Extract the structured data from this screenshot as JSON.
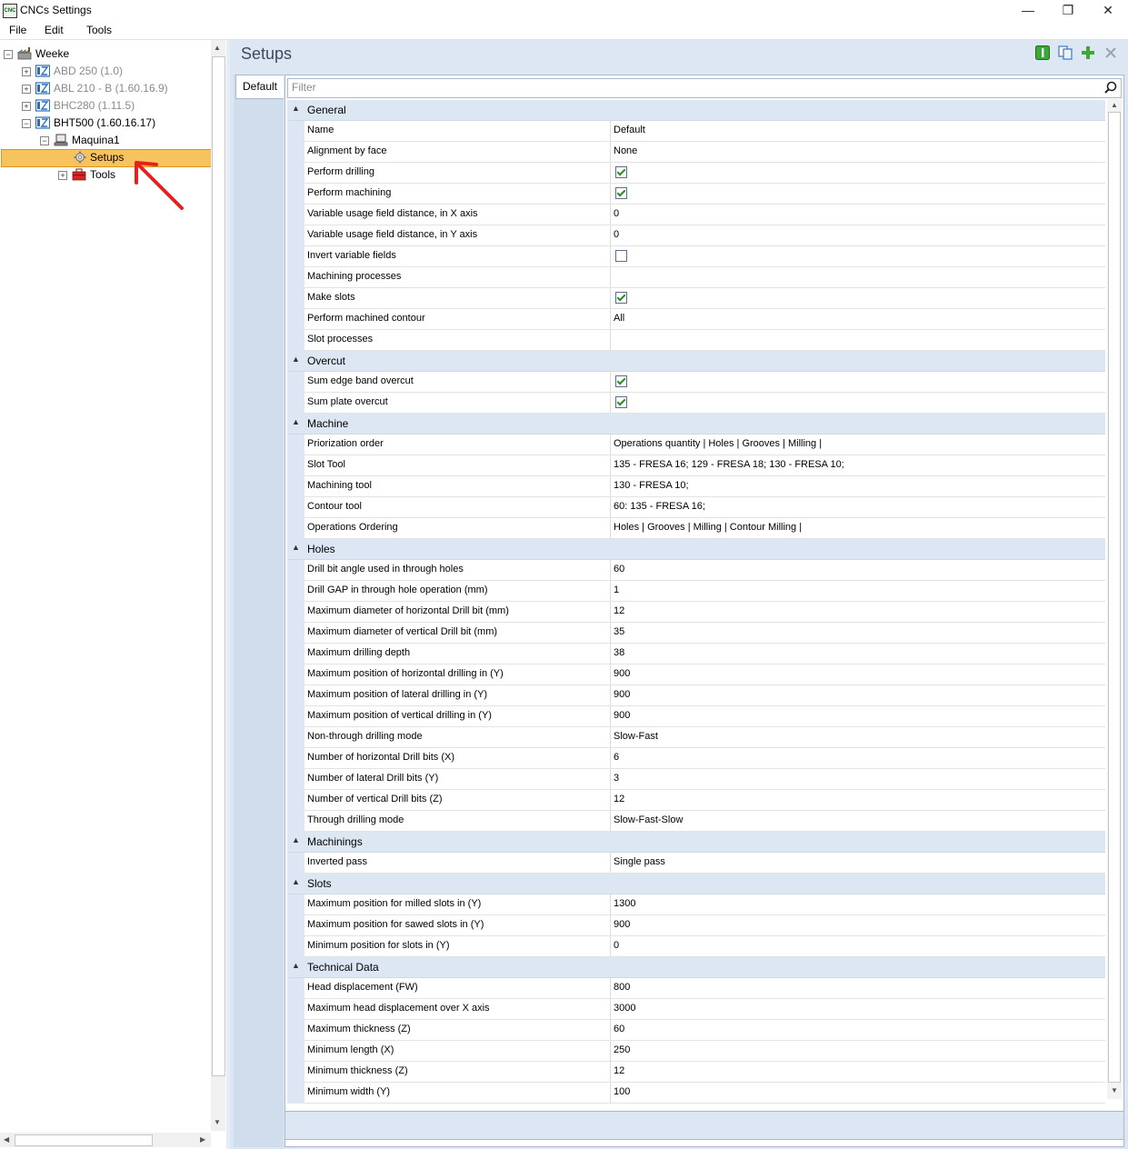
{
  "window": {
    "title": "CNCs Settings",
    "app_icon_text": "CNC"
  },
  "menu": [
    "File",
    "Edit",
    "Tools"
  ],
  "tree": {
    "root": "Weeke",
    "machines": [
      {
        "label": "ABD 250 (1.0)",
        "disabled": true
      },
      {
        "label": "ABL 210 - B (1.60.16.9)",
        "disabled": true
      },
      {
        "label": "BHC280 (1.11.5)",
        "disabled": true
      },
      {
        "label": "BHT500 (1.60.16.17)",
        "disabled": false
      }
    ],
    "machine_child": "Maquina1",
    "setups": "Setups",
    "tools": "Tools"
  },
  "header": {
    "title": "Setups"
  },
  "tabs": [
    "Default"
  ],
  "filter": {
    "placeholder": "Filter",
    "value": ""
  },
  "categories": [
    {
      "name": "General",
      "rows": [
        {
          "name": "Name",
          "value": "Default"
        },
        {
          "name": "Alignment by face",
          "value": "None"
        },
        {
          "name": "Perform drilling",
          "checked": true
        },
        {
          "name": "Perform machining",
          "checked": true
        },
        {
          "name": "Variable usage field distance, in X axis",
          "value": "0"
        },
        {
          "name": "Variable usage field distance, in Y axis",
          "value": "0"
        },
        {
          "name": "Invert variable fields",
          "checked": false
        },
        {
          "name": "Machining processes",
          "value": ""
        },
        {
          "name": "Make slots",
          "checked": true
        },
        {
          "name": "Perform machined contour",
          "value": "All"
        },
        {
          "name": "Slot processes",
          "value": ""
        }
      ]
    },
    {
      "name": "Overcut",
      "rows": [
        {
          "name": "Sum edge band overcut",
          "checked": true
        },
        {
          "name": "Sum plate overcut",
          "checked": true
        }
      ]
    },
    {
      "name": "Machine",
      "rows": [
        {
          "name": "Priorization order",
          "value": "Operations quantity | Holes | Grooves | Milling |"
        },
        {
          "name": "Slot Tool",
          "value": "135 - FRESA 16; 129 - FRESA 18; 130 - FRESA 10;"
        },
        {
          "name": "Machining tool",
          "value": "130 - FRESA 10;"
        },
        {
          "name": "Contour tool",
          "value": "60: 135 - FRESA 16;"
        },
        {
          "name": "Operations Ordering",
          "value": "Holes | Grooves | Milling | Contour Milling |"
        }
      ]
    },
    {
      "name": "Holes",
      "rows": [
        {
          "name": "Drill bit angle used in through holes",
          "value": "60"
        },
        {
          "name": "Drill GAP in through hole operation (mm)",
          "value": "1"
        },
        {
          "name": "Maximum diameter of horizontal Drill bit (mm)",
          "value": "12"
        },
        {
          "name": "Maximum diameter of vertical Drill bit (mm)",
          "value": "35"
        },
        {
          "name": "Maximum drilling depth",
          "value": "38"
        },
        {
          "name": "Maximum position of horizontal drilling in (Y)",
          "value": "900"
        },
        {
          "name": "Maximum position of lateral drilling in (Y)",
          "value": "900"
        },
        {
          "name": "Maximum position of vertical drilling in (Y)",
          "value": "900"
        },
        {
          "name": "Non-through drilling mode",
          "value": "Slow-Fast"
        },
        {
          "name": "Number of horizontal Drill bits (X)",
          "value": "6"
        },
        {
          "name": "Number of lateral Drill bits (Y)",
          "value": "3"
        },
        {
          "name": "Number of vertical Drill bits (Z)",
          "value": "12"
        },
        {
          "name": "Through drilling mode",
          "value": "Slow-Fast-Slow"
        }
      ]
    },
    {
      "name": "Machinings",
      "rows": [
        {
          "name": "Inverted pass",
          "value": "Single pass"
        }
      ]
    },
    {
      "name": "Slots",
      "rows": [
        {
          "name": "Maximum position for milled slots in (Y)",
          "value": "1300"
        },
        {
          "name": "Maximum position for sawed slots in (Y)",
          "value": "900"
        },
        {
          "name": "Minimum position for slots in (Y)",
          "value": "0"
        }
      ]
    },
    {
      "name": "Technical Data",
      "rows": [
        {
          "name": "Head displacement (FW)",
          "value": "800"
        },
        {
          "name": "Maximum head displacement over X axis",
          "value": "3000"
        },
        {
          "name": "Maximum thickness (Z)",
          "value": "60"
        },
        {
          "name": "Minimum length (X)",
          "value": "250"
        },
        {
          "name": "Minimum thickness (Z)",
          "value": "12"
        },
        {
          "name": "Minimum width (Y)",
          "value": "100"
        }
      ]
    }
  ],
  "colors": {
    "selection": "#f7c35f",
    "accent_red": "#e5201f",
    "add_green": "#3aa935"
  },
  "icons": {
    "root": "factory-icon",
    "machine": "cnc-machine-icon",
    "machine_child": "computer-icon",
    "setups": "gear-icon",
    "tools": "toolbox-icon",
    "header_buttons": [
      "info-icon",
      "copy-icon",
      "add-icon",
      "close-icon"
    ]
  }
}
